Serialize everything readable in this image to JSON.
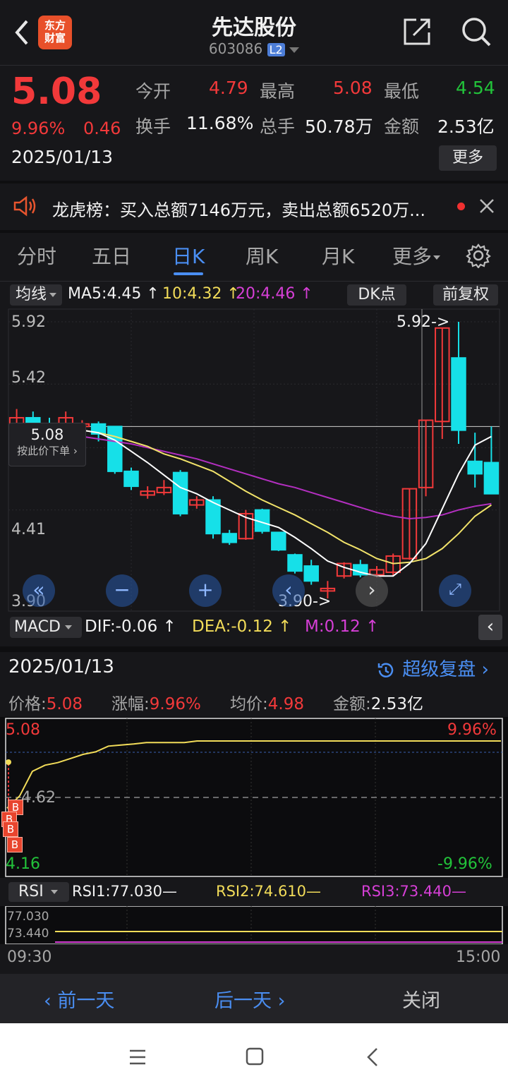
{
  "header": {
    "title": "先达股份",
    "code": "603086",
    "level_badge": "L2",
    "logo_line1": "东方",
    "logo_line2": "财富"
  },
  "quote": {
    "price": "5.08",
    "change_pct": "9.96%",
    "change": "0.46",
    "date": "2025/01/13",
    "open_label": "今开",
    "open": "4.79",
    "high_label": "最高",
    "high": "5.08",
    "low_label": "最低",
    "low": "4.54",
    "turnover_label": "换手",
    "turnover": "11.68%",
    "volume_label": "总手",
    "volume": "50.78万",
    "amount_label": "金额",
    "amount": "2.53亿",
    "more_label": "更多"
  },
  "news": {
    "text": "龙虎榜：买入总额7146万元，卖出总额6520万..."
  },
  "tabs": {
    "items": [
      "分时",
      "五日",
      "日K",
      "周K",
      "月K",
      "更多"
    ],
    "active": "日K"
  },
  "kline_toolbar": {
    "ma_select": "均线",
    "ma5": "MA5:4.45",
    "ma10": "10:4.32",
    "ma20": "20:4.46",
    "dk_label": "DK点",
    "adjust_label": "前复权"
  },
  "kline": {
    "ylabels": [
      "5.92",
      "5.42",
      "4.41",
      "3.90"
    ],
    "price_tag": "5.08",
    "price_tag_sub": "按此价下单",
    "max_annot": "5.92->",
    "min_annot": "3.90->",
    "candles": [
      {
        "o": 5.06,
        "c": 5.15,
        "h": 5.22,
        "l": 5.0
      },
      {
        "o": 5.15,
        "c": 5.1,
        "h": 5.2,
        "l": 5.05
      },
      {
        "o": 5.1,
        "c": 5.05,
        "h": 5.15,
        "l": 5.0
      },
      {
        "o": 5.05,
        "c": 5.15,
        "h": 5.2,
        "l": 5.02
      },
      {
        "o": 5.08,
        "c": 5.1,
        "h": 5.13,
        "l": 5.04
      },
      {
        "o": 5.1,
        "c": 5.02,
        "h": 5.12,
        "l": 4.96
      },
      {
        "o": 5.08,
        "c": 4.72,
        "h": 5.08,
        "l": 4.7
      },
      {
        "o": 4.72,
        "c": 4.6,
        "h": 4.75,
        "l": 4.57
      },
      {
        "o": 4.53,
        "c": 4.56,
        "h": 4.6,
        "l": 4.5
      },
      {
        "o": 4.55,
        "c": 4.59,
        "h": 4.65,
        "l": 4.53
      },
      {
        "o": 4.71,
        "c": 4.38,
        "h": 4.73,
        "l": 4.36
      },
      {
        "o": 4.45,
        "c": 4.49,
        "h": 4.52,
        "l": 4.42
      },
      {
        "o": 4.49,
        "c": 4.22,
        "h": 4.52,
        "l": 4.18
      },
      {
        "o": 4.22,
        "c": 4.15,
        "h": 4.25,
        "l": 4.13
      },
      {
        "o": 4.18,
        "c": 4.38,
        "h": 4.41,
        "l": 4.17
      },
      {
        "o": 4.41,
        "c": 4.24,
        "h": 4.42,
        "l": 4.22
      },
      {
        "o": 4.23,
        "c": 4.09,
        "h": 4.23,
        "l": 4.08
      },
      {
        "o": 4.05,
        "c": 3.92,
        "h": 4.06,
        "l": 3.9
      },
      {
        "o": 3.96,
        "c": 3.84,
        "h": 4.01,
        "l": 3.81
      },
      {
        "o": 3.76,
        "c": 3.78,
        "h": 3.84,
        "l": 3.7
      },
      {
        "o": 3.88,
        "c": 3.98,
        "h": 3.99,
        "l": 3.86
      },
      {
        "o": 3.97,
        "c": 3.89,
        "h": 4.01,
        "l": 3.87
      },
      {
        "o": 3.89,
        "c": 3.93,
        "h": 3.96,
        "l": 3.87
      },
      {
        "o": 3.91,
        "c": 4.04,
        "h": 4.06,
        "l": 3.88
      },
      {
        "o": 4.02,
        "c": 4.58,
        "h": 4.58,
        "l": 4.01
      },
      {
        "o": 4.59,
        "c": 5.13,
        "h": 5.13,
        "l": 4.52
      },
      {
        "o": 5.12,
        "c": 5.87,
        "h": 5.87,
        "l": 4.98
      },
      {
        "o": 5.63,
        "c": 5.05,
        "h": 5.92,
        "l": 4.94
      },
      {
        "o": 4.8,
        "c": 4.7,
        "h": 5.03,
        "l": 4.59
      },
      {
        "o": 4.79,
        "c": 4.54,
        "h": 5.08,
        "l": 4.54
      }
    ],
    "ma5": [
      5.1,
      5.1,
      5.08,
      5.07,
      5.05,
      5.03,
      4.97,
      4.88,
      4.79,
      4.69,
      4.59,
      4.54,
      4.47,
      4.41,
      4.35,
      4.31,
      4.27,
      4.19,
      4.1,
      4.0,
      3.95,
      3.91,
      3.88,
      3.88,
      3.98,
      4.14,
      4.42,
      4.7,
      4.93,
      5.0
    ],
    "ma10": [
      5.08,
      5.07,
      5.07,
      5.06,
      5.05,
      5.03,
      5.0,
      4.96,
      4.92,
      4.86,
      4.82,
      4.77,
      4.72,
      4.64,
      4.56,
      4.49,
      4.43,
      4.37,
      4.3,
      4.23,
      4.15,
      4.09,
      4.02,
      3.98,
      3.99,
      4.02,
      4.1,
      4.22,
      4.36,
      4.45
    ],
    "ma20": [
      5.05,
      5.04,
      5.03,
      5.02,
      5.0,
      4.98,
      4.96,
      4.94,
      4.91,
      4.88,
      4.85,
      4.82,
      4.78,
      4.74,
      4.7,
      4.66,
      4.62,
      4.59,
      4.55,
      4.51,
      4.47,
      4.43,
      4.39,
      4.36,
      4.34,
      4.35,
      4.37,
      4.41,
      4.44,
      4.46
    ]
  },
  "macd": {
    "select": "MACD",
    "dif": "DIF:-0.06",
    "dea": "DEA:-0.12",
    "m": "M:0.12"
  },
  "detail": {
    "date": "2025/01/13",
    "review_label": "超级复盘",
    "price_label": "价格:",
    "price": "5.08",
    "pct_label": "涨幅:",
    "pct": "9.96%",
    "avg_label": "均价:",
    "avg": "4.98",
    "amt_label": "金额:",
    "amt": "2.53亿"
  },
  "intraday": {
    "top_price": "5.08",
    "top_pct": "9.96%",
    "mid_price": "4.62",
    "bottom_price": "4.16",
    "bottom_pct": "-9.96%",
    "b_marks": [
      "B",
      "B",
      "B",
      "B"
    ],
    "series": [
      4.55,
      4.63,
      4.79,
      4.83,
      4.98,
      5.0,
      5.02,
      5.03,
      5.06,
      5.06,
      5.06,
      5.07,
      5.07,
      5.07,
      5.07,
      5.08,
      5.08,
      5.08,
      5.08,
      5.08,
      5.08,
      5.08,
      5.08,
      5.08,
      5.08,
      5.08,
      5.08,
      5.08,
      5.08,
      5.08,
      5.08,
      5.08,
      5.08,
      5.08,
      5.08,
      5.08,
      5.08,
      5.08,
      5.08,
      5.08
    ]
  },
  "rsi": {
    "select": "RSI",
    "rsi1": "RSI1:77.030—",
    "rsi2": "RSI2:74.610—",
    "rsi3": "RSI3:73.440—",
    "label_top": "77.030",
    "label_bottom": "73.440"
  },
  "time_axis": {
    "start": "09:30",
    "end": "15:00"
  },
  "footer": {
    "prev_day": "前一天",
    "next_day": "后一天",
    "close": "关闭"
  },
  "colors": {
    "up": "#f2393a",
    "down": "#16e0e8",
    "ma5": "#ffffff",
    "ma10": "#f2e36a",
    "ma20": "#b32fc0",
    "accent": "#4a8ef2"
  }
}
